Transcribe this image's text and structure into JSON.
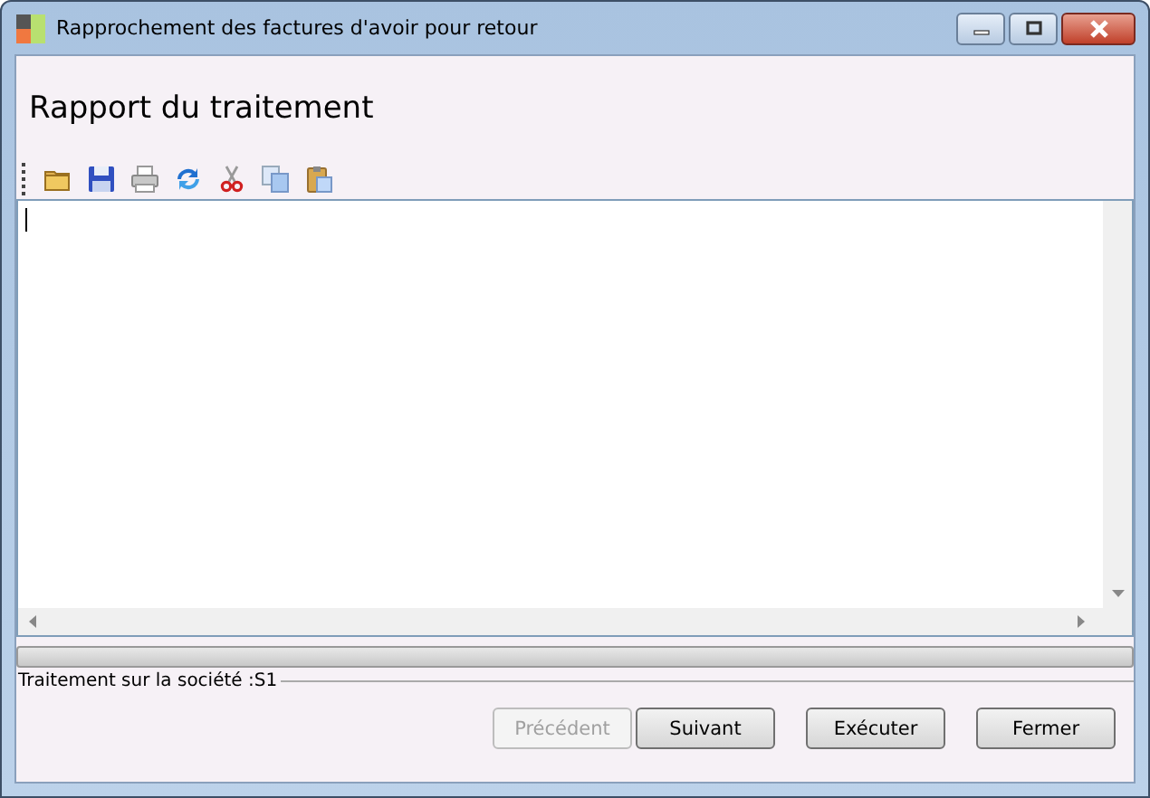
{
  "window": {
    "title": "Rapprochement des factures d'avoir pour retour"
  },
  "heading": "Rapport du traitement",
  "toolbar": [
    {
      "kind": "folder"
    },
    {
      "kind": "save"
    },
    {
      "kind": "print"
    },
    {
      "kind": "refresh"
    },
    {
      "kind": "cut"
    },
    {
      "kind": "copy"
    },
    {
      "kind": "paste"
    }
  ],
  "progress": {
    "level": 0
  },
  "status": "Traitement sur la société :S1",
  "buttons": [
    {
      "label": "Précédent",
      "disabled": true
    },
    {
      "label": "Suivant",
      "disabled": false
    },
    {
      "label": "Exécuter",
      "disabled": false
    },
    {
      "label": "Fermer",
      "disabled": false
    }
  ]
}
